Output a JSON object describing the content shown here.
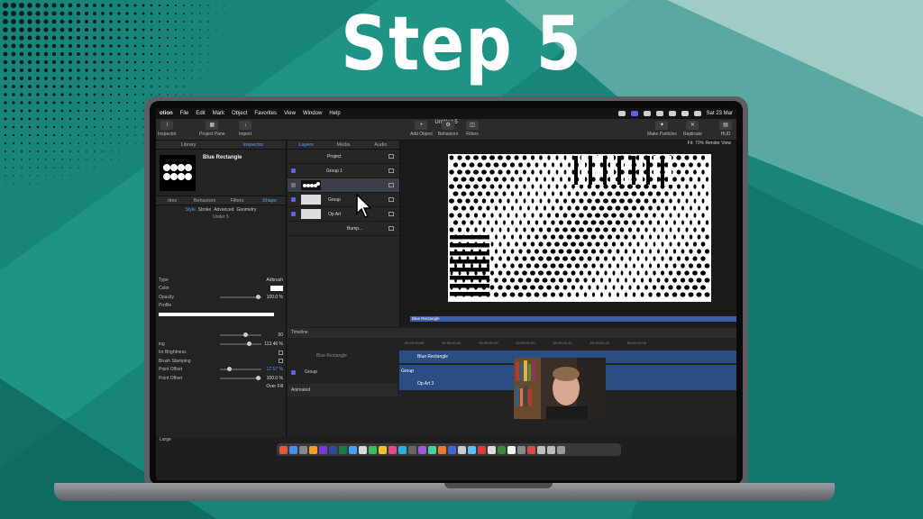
{
  "overlay": {
    "title": "Step 5"
  },
  "menubar": {
    "app": "otion",
    "items": [
      "File",
      "Edit",
      "Mark",
      "Object",
      "Favorites",
      "View",
      "Window",
      "Help"
    ],
    "date": "Sat 23 Mar"
  },
  "toolbar": {
    "doc_title": "Untitled 5",
    "inspector": "Inspector",
    "project_pane": "Project Pane",
    "import": "Import",
    "add_object": "Add Object",
    "behaviors": "Behaviors",
    "filters": "Filters",
    "make_particles": "Make Particles",
    "replicate": "Replicate",
    "hud": "HUD"
  },
  "inspector": {
    "tabs": [
      "Library",
      "Inspector"
    ],
    "object_name": "Blue Rectangle",
    "subtabs": [
      "rties",
      "Behaviors",
      "Filters",
      "Shape"
    ],
    "shape_tabs": [
      "Style",
      "Stroke",
      "Advanced",
      "Geometry"
    ],
    "section": "Under 5",
    "rows": [
      {
        "name": "Type",
        "value": "Airbrush"
      },
      {
        "name": "Color",
        "value": ""
      },
      {
        "name": "Opacity",
        "value": "100.0 %"
      },
      {
        "name": "Profile",
        "value": ""
      },
      {
        "name": "",
        "value": "50"
      },
      {
        "name": "ing",
        "value": "113.46 %"
      },
      {
        "name": "lor Brightness",
        "value": ""
      },
      {
        "name": "Brush Stamping",
        "value": ""
      },
      {
        "name": "Point Offset",
        "value": "17.57 %"
      },
      {
        "name": "Point Offset",
        "value": "100.0 %"
      },
      {
        "name": "",
        "value": "Over Fill"
      }
    ]
  },
  "layers": {
    "tabs": [
      "Layers",
      "Media",
      "Audio"
    ],
    "rows": [
      "Project",
      "Group 1",
      "",
      "Group",
      "Op Art",
      "Bump..."
    ]
  },
  "canvas": {
    "fit": "Fit: 70%",
    "render": "Render",
    "view": "View",
    "selection_label": "Blue Rectangle"
  },
  "timeline": {
    "title": "Timeline",
    "ruler": [
      "00:00:00:00",
      "00:00:00:10",
      "00:00:00:20",
      "00:00:01:00",
      "00:00:01:10",
      "00:00:01:20",
      "00:00:02:00"
    ],
    "layers": [
      "Blue Rectangle",
      "Group",
      "Animated"
    ],
    "tracks": [
      "Blue Rectangle",
      "Group",
      "Op Art 3"
    ],
    "zoom": "Large"
  },
  "colors": {
    "accent": "#5b9cff",
    "track": "#2b4d85",
    "bg_teal": "#1d8a7a"
  }
}
